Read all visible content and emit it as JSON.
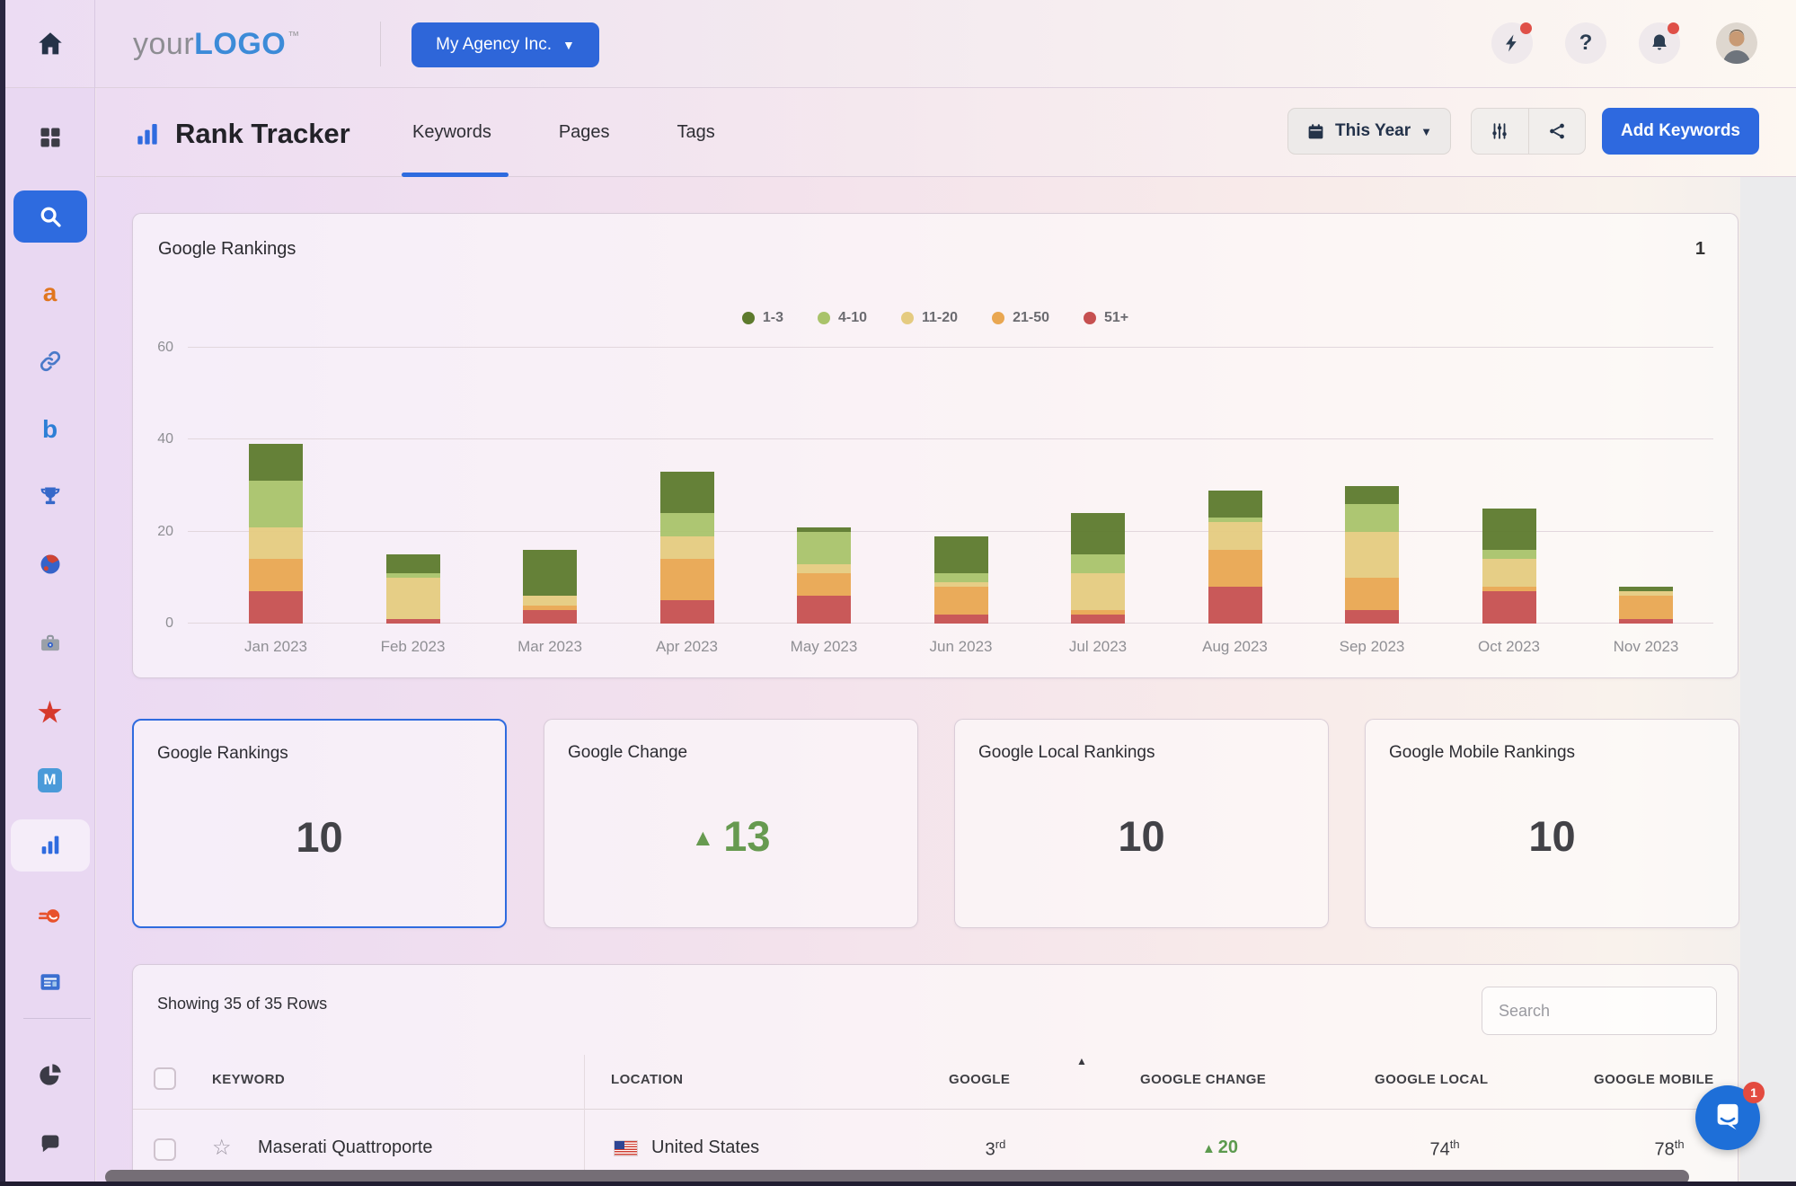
{
  "topbar": {
    "logo": {
      "prefix": "your",
      "brand": "LOGO",
      "tm": "™"
    },
    "agency_button": {
      "label": "My Agency Inc."
    },
    "actions": [
      {
        "icon": "lightning-icon",
        "name": "quick-actions",
        "badge": true
      },
      {
        "icon": "question-icon",
        "name": "help",
        "badge": false
      },
      {
        "icon": "bell-icon",
        "name": "notifications",
        "badge": true
      }
    ]
  },
  "sidebar": {
    "main_items": [
      {
        "icon": "grid-icon",
        "name": "dashboard",
        "style": "plain"
      },
      {
        "icon": "search-icon",
        "name": "search",
        "style": "pill"
      },
      {
        "icon": "letter-a-icon",
        "name": "letter-a-tool",
        "style": "plain"
      },
      {
        "icon": "link-icon",
        "name": "backlinks",
        "style": "plain"
      },
      {
        "icon": "bing-icon",
        "name": "bing",
        "style": "plain"
      },
      {
        "icon": "trophy-icon",
        "name": "competitors",
        "style": "plain"
      },
      {
        "icon": "globe-icon",
        "name": "web",
        "style": "plain"
      },
      {
        "icon": "toolbox-icon",
        "name": "toolbox",
        "style": "plain"
      },
      {
        "icon": "star-icon",
        "name": "reviews",
        "style": "plain"
      },
      {
        "icon": "m-icon",
        "name": "mail-tool",
        "style": "plain"
      },
      {
        "icon": "bar-chart-icon",
        "name": "rank-tracker",
        "style": "sel"
      },
      {
        "icon": "comet-icon",
        "name": "semrush-tool",
        "style": "plain"
      },
      {
        "icon": "browser-icon",
        "name": "reports",
        "style": "plain"
      }
    ],
    "footer_items": [
      {
        "icon": "pie-chart-icon",
        "name": "analytics"
      },
      {
        "icon": "chat-icon",
        "name": "messages"
      }
    ]
  },
  "subheader": {
    "title": "Rank Tracker",
    "tabs": [
      {
        "label": "Keywords",
        "active": true
      },
      {
        "label": "Pages",
        "active": false
      },
      {
        "label": "Tags",
        "active": false
      }
    ],
    "period_button": {
      "label": "This Year"
    },
    "primary_button": {
      "label": "Add Keywords"
    }
  },
  "chart_card": {
    "title": "Google Rankings",
    "corner_label": "1"
  },
  "chart_data": {
    "type": "stacked-bar",
    "title": "Google Rankings",
    "categories": [
      "Jan 2023",
      "Feb 2023",
      "Mar 2023",
      "Apr 2023",
      "May 2023",
      "Jun 2023",
      "Jul 2023",
      "Aug 2023",
      "Sep 2023",
      "Oct 2023",
      "Nov 2023"
    ],
    "series": [
      {
        "name": "1-3",
        "color": "#5d7a2d",
        "values": [
          8,
          4,
          10,
          9,
          1,
          8,
          9,
          6,
          4,
          9,
          1
        ]
      },
      {
        "name": "4-10",
        "color": "#a9c36a",
        "values": [
          10,
          1,
          0,
          5,
          7,
          2,
          4,
          1,
          6,
          2,
          0
        ]
      },
      {
        "name": "11-20",
        "color": "#e5cb80",
        "values": [
          7,
          9,
          2,
          5,
          2,
          1,
          8,
          6,
          10,
          6,
          1
        ]
      },
      {
        "name": "21-50",
        "color": "#e9a751",
        "values": [
          7,
          0,
          1,
          9,
          5,
          6,
          1,
          8,
          7,
          1,
          5
        ]
      },
      {
        "name": "51+",
        "color": "#c65050",
        "values": [
          7,
          1,
          3,
          5,
          6,
          2,
          2,
          8,
          3,
          7,
          1
        ]
      }
    ],
    "stack_order_bottom_to_top": [
      "51+",
      "21-50",
      "11-20",
      "4-10",
      "1-3"
    ],
    "ylim": [
      0,
      60
    ],
    "yticks": [
      0,
      20,
      40,
      60
    ],
    "legend_position": "top-center",
    "grid": true
  },
  "stat_cards": [
    {
      "title": "Google Rankings",
      "value": "10",
      "selected": true
    },
    {
      "title": "Google Change",
      "value": "13",
      "direction": "up"
    },
    {
      "title": "Google Local Rankings",
      "value": "10",
      "selected": false
    },
    {
      "title": "Google Mobile Rankings",
      "value": "10",
      "selected": false
    }
  ],
  "table": {
    "summary": "Showing 35 of 35 Rows",
    "search_placeholder": "Search",
    "columns": [
      "KEYWORD",
      "LOCATION",
      "GOOGLE",
      "GOOGLE CHANGE",
      "GOOGLE LOCAL",
      "GOOGLE MOBILE"
    ],
    "sort_column": "GOOGLE",
    "sort_direction": "asc",
    "rows": [
      {
        "keyword": "Maserati Quattroporte",
        "location": "United States",
        "google_num": "3",
        "google_ord": "rd",
        "change": "20",
        "change_direction": "up",
        "local_num": "74",
        "local_ord": "th",
        "mobile_num": "78",
        "mobile_ord": "th"
      }
    ]
  },
  "chat_widget": {
    "badge": "1"
  },
  "colors": {
    "accent_blue": "#2e6bdf",
    "positive_green": "#679a50",
    "badge_red": "#e34b40",
    "brand_blue": "#3c8bd8"
  }
}
